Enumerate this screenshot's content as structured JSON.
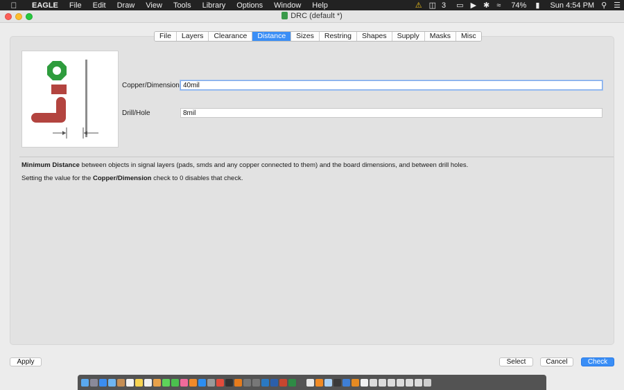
{
  "menubar": {
    "app": "EAGLE",
    "items": [
      "File",
      "Edit",
      "Draw",
      "View",
      "Tools",
      "Library",
      "Options",
      "Window",
      "Help"
    ],
    "status": {
      "notifications": "3",
      "battery": "74%",
      "clock": "Sun 4:54 PM"
    }
  },
  "window": {
    "title": "DRC (default *)"
  },
  "tabs": [
    "File",
    "Layers",
    "Clearance",
    "Distance",
    "Sizes",
    "Restring",
    "Shapes",
    "Supply",
    "Masks",
    "Misc"
  ],
  "active_tab": "Distance",
  "form": {
    "copper_label": "Copper/Dimension",
    "copper_value": "40mil",
    "drill_label": "Drill/Hole",
    "drill_value": "8mil"
  },
  "description": {
    "line1_bold": "Minimum Distance",
    "line1_rest": " between objects in signal layers (pads, smds and any copper connected to them) and the board dimensions, and between drill holes.",
    "line2_pre": "Setting the value for the ",
    "line2_bold": "Copper/Dimension",
    "line2_post": " check to 0 disables that check."
  },
  "buttons": {
    "apply": "Apply",
    "select": "Select",
    "cancel": "Cancel",
    "check": "Check"
  },
  "colors": {
    "accent": "#3a8ef6",
    "pad_green": "#2e9c3d",
    "copper_red": "#b3443f"
  },
  "dock": {
    "apps": [
      {
        "icon": "finder-icon",
        "color": "#5aa9ef"
      },
      {
        "icon": "launchpad-icon",
        "color": "#8a8a9a"
      },
      {
        "icon": "safari-icon",
        "color": "#3b8df0"
      },
      {
        "icon": "mail-icon",
        "color": "#6fb5f1"
      },
      {
        "icon": "contacts-icon",
        "color": "#c58e55"
      },
      {
        "icon": "calendar-icon",
        "color": "#f2f2f2"
      },
      {
        "icon": "notes-icon",
        "color": "#f7d351"
      },
      {
        "icon": "reminders-icon",
        "color": "#f0f0f0"
      },
      {
        "icon": "photos-icon",
        "color": "#e9a24a"
      },
      {
        "icon": "messages-icon",
        "color": "#5ed35a"
      },
      {
        "icon": "facetime-icon",
        "color": "#4bc14e"
      },
      {
        "icon": "itunes-icon",
        "color": "#f06b9b"
      },
      {
        "icon": "books-icon",
        "color": "#f08a2a"
      },
      {
        "icon": "appstore-icon",
        "color": "#2d8ef0"
      },
      {
        "icon": "preferences-icon",
        "color": "#9a9a9a"
      },
      {
        "icon": "chrome-icon",
        "color": "#e24c3c"
      },
      {
        "icon": "terminal-icon",
        "color": "#333333"
      },
      {
        "icon": "illustrator-icon",
        "color": "#e57b1c"
      },
      {
        "icon": "help-icon",
        "color": "#777777"
      },
      {
        "icon": "help-icon-2",
        "color": "#777777"
      },
      {
        "icon": "photoshop-icon",
        "color": "#2a79c2"
      },
      {
        "icon": "word-icon",
        "color": "#2b5faa"
      },
      {
        "icon": "powerpoint-icon",
        "color": "#c8462f"
      },
      {
        "icon": "excel-icon",
        "color": "#2e8b45"
      },
      {
        "icon": "dictionary-icon",
        "color": "#555555"
      },
      {
        "icon": "pages-icon",
        "color": "#e8e8e8"
      },
      {
        "icon": "blender-icon",
        "color": "#f08a24"
      },
      {
        "icon": "preview-icon",
        "color": "#a8d0f5"
      },
      {
        "icon": "activity-icon",
        "color": "#3a3a3a"
      },
      {
        "icon": "xcode-icon",
        "color": "#3e7fd6"
      },
      {
        "icon": "eagle-icon",
        "color": "#e58a22"
      },
      {
        "icon": "document-icon",
        "color": "#f2f2f2"
      },
      {
        "icon": "window-icon",
        "color": "#dcdcdc"
      },
      {
        "icon": "window-icon-2",
        "color": "#dcdcdc"
      },
      {
        "icon": "window-icon-3",
        "color": "#dcdcdc"
      },
      {
        "icon": "window-icon-4",
        "color": "#dcdcdc"
      },
      {
        "icon": "window-icon-5",
        "color": "#dcdcdc"
      },
      {
        "icon": "window-icon-6",
        "color": "#dcdcdc"
      },
      {
        "icon": "trash-icon",
        "color": "#cfcfcf"
      }
    ]
  }
}
